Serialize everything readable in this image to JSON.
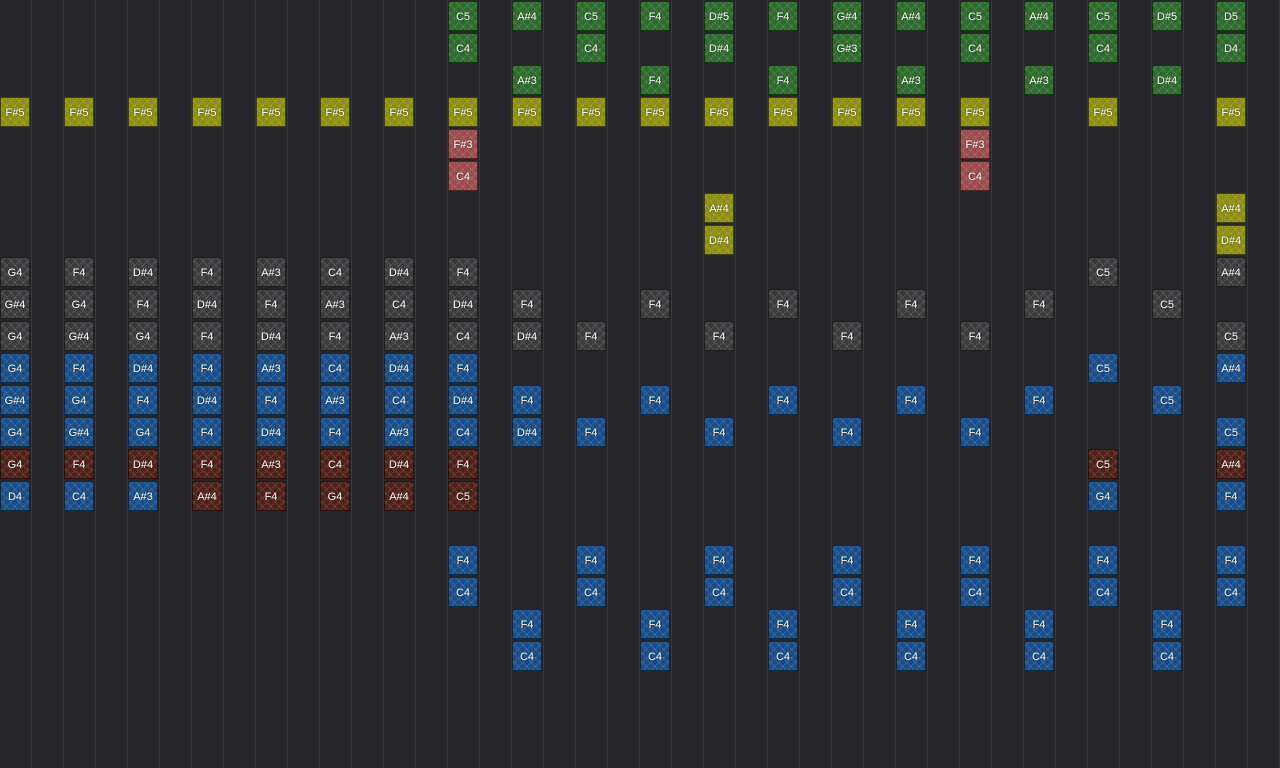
{
  "colors": {
    "background": "#262628",
    "green": "#2e6b2e",
    "yellow": "#8e8e12",
    "red": "#9c4d4e",
    "gray": "#3c3c3e",
    "blue": "#1b4e88",
    "maroon": "#4f2118"
  },
  "column_count": 40,
  "notes": [
    {
      "col": 14,
      "row": 0,
      "label": "C5",
      "kind": "green"
    },
    {
      "col": 14,
      "row": 1,
      "label": "C4",
      "kind": "green"
    },
    {
      "col": 16,
      "row": 0,
      "label": "A#4",
      "kind": "green"
    },
    {
      "col": 16,
      "row": 2,
      "label": "A#3",
      "kind": "green"
    },
    {
      "col": 18,
      "row": 0,
      "label": "C5",
      "kind": "green"
    },
    {
      "col": 18,
      "row": 1,
      "label": "C4",
      "kind": "green"
    },
    {
      "col": 20,
      "row": 0,
      "label": "F4",
      "kind": "green"
    },
    {
      "col": 20,
      "row": 2,
      "label": "F4",
      "kind": "green"
    },
    {
      "col": 22,
      "row": 0,
      "label": "D#5",
      "kind": "green"
    },
    {
      "col": 22,
      "row": 1,
      "label": "D#4",
      "kind": "green"
    },
    {
      "col": 24,
      "row": 0,
      "label": "F4",
      "kind": "green"
    },
    {
      "col": 24,
      "row": 2,
      "label": "F4",
      "kind": "green"
    },
    {
      "col": 26,
      "row": 0,
      "label": "G#4",
      "kind": "green"
    },
    {
      "col": 26,
      "row": 1,
      "label": "G#3",
      "kind": "green"
    },
    {
      "col": 28,
      "row": 0,
      "label": "A#4",
      "kind": "green"
    },
    {
      "col": 28,
      "row": 2,
      "label": "A#3",
      "kind": "green"
    },
    {
      "col": 30,
      "row": 0,
      "label": "C5",
      "kind": "green"
    },
    {
      "col": 30,
      "row": 1,
      "label": "C4",
      "kind": "green"
    },
    {
      "col": 32,
      "row": 0,
      "label": "A#4",
      "kind": "green"
    },
    {
      "col": 32,
      "row": 2,
      "label": "A#3",
      "kind": "green"
    },
    {
      "col": 34,
      "row": 0,
      "label": "C5",
      "kind": "green"
    },
    {
      "col": 34,
      "row": 1,
      "label": "C4",
      "kind": "green"
    },
    {
      "col": 36,
      "row": 0,
      "label": "D#5",
      "kind": "green"
    },
    {
      "col": 36,
      "row": 2,
      "label": "D#4",
      "kind": "green"
    },
    {
      "col": 38,
      "row": 0,
      "label": "D5",
      "kind": "green"
    },
    {
      "col": 38,
      "row": 1,
      "label": "D4",
      "kind": "green"
    },
    {
      "col": 0,
      "row": 3,
      "label": "F#5",
      "kind": "yellow"
    },
    {
      "col": 2,
      "row": 3,
      "label": "F#5",
      "kind": "yellow"
    },
    {
      "col": 4,
      "row": 3,
      "label": "F#5",
      "kind": "yellow"
    },
    {
      "col": 6,
      "row": 3,
      "label": "F#5",
      "kind": "yellow"
    },
    {
      "col": 8,
      "row": 3,
      "label": "F#5",
      "kind": "yellow"
    },
    {
      "col": 10,
      "row": 3,
      "label": "F#5",
      "kind": "yellow"
    },
    {
      "col": 12,
      "row": 3,
      "label": "F#5",
      "kind": "yellow"
    },
    {
      "col": 14,
      "row": 3,
      "label": "F#5",
      "kind": "yellow"
    },
    {
      "col": 16,
      "row": 3,
      "label": "F#5",
      "kind": "yellow"
    },
    {
      "col": 18,
      "row": 3,
      "label": "F#5",
      "kind": "yellow"
    },
    {
      "col": 20,
      "row": 3,
      "label": "F#5",
      "kind": "yellow"
    },
    {
      "col": 22,
      "row": 3,
      "label": "F#5",
      "kind": "yellow"
    },
    {
      "col": 24,
      "row": 3,
      "label": "F#5",
      "kind": "yellow"
    },
    {
      "col": 26,
      "row": 3,
      "label": "F#5",
      "kind": "yellow"
    },
    {
      "col": 28,
      "row": 3,
      "label": "F#5",
      "kind": "yellow"
    },
    {
      "col": 30,
      "row": 3,
      "label": "F#5",
      "kind": "yellow"
    },
    {
      "col": 34,
      "row": 3,
      "label": "F#5",
      "kind": "yellow"
    },
    {
      "col": 38,
      "row": 3,
      "label": "F#5",
      "kind": "yellow"
    },
    {
      "col": 14,
      "row": 4,
      "label": "F#3",
      "kind": "red"
    },
    {
      "col": 14,
      "row": 5,
      "label": "C4",
      "kind": "red"
    },
    {
      "col": 30,
      "row": 4,
      "label": "F#3",
      "kind": "red"
    },
    {
      "col": 30,
      "row": 5,
      "label": "C4",
      "kind": "red"
    },
    {
      "col": 22,
      "row": 6,
      "label": "A#4",
      "kind": "yellow"
    },
    {
      "col": 22,
      "row": 7,
      "label": "D#4",
      "kind": "yellow"
    },
    {
      "col": 38,
      "row": 6,
      "label": "A#4",
      "kind": "yellow"
    },
    {
      "col": 38,
      "row": 7,
      "label": "D#4",
      "kind": "yellow"
    },
    {
      "col": 0,
      "row": 8,
      "label": "G4",
      "kind": "gray"
    },
    {
      "col": 2,
      "row": 8,
      "label": "F4",
      "kind": "gray"
    },
    {
      "col": 4,
      "row": 8,
      "label": "D#4",
      "kind": "gray"
    },
    {
      "col": 6,
      "row": 8,
      "label": "F4",
      "kind": "gray"
    },
    {
      "col": 8,
      "row": 8,
      "label": "A#3",
      "kind": "gray"
    },
    {
      "col": 10,
      "row": 8,
      "label": "C4",
      "kind": "gray"
    },
    {
      "col": 12,
      "row": 8,
      "label": "D#4",
      "kind": "gray"
    },
    {
      "col": 14,
      "row": 8,
      "label": "F4",
      "kind": "gray"
    },
    {
      "col": 34,
      "row": 8,
      "label": "C5",
      "kind": "gray"
    },
    {
      "col": 38,
      "row": 8,
      "label": "A#4",
      "kind": "gray"
    },
    {
      "col": 0,
      "row": 9,
      "label": "G#4",
      "kind": "gray"
    },
    {
      "col": 2,
      "row": 9,
      "label": "G4",
      "kind": "gray"
    },
    {
      "col": 4,
      "row": 9,
      "label": "F4",
      "kind": "gray"
    },
    {
      "col": 6,
      "row": 9,
      "label": "D#4",
      "kind": "gray"
    },
    {
      "col": 8,
      "row": 9,
      "label": "F4",
      "kind": "gray"
    },
    {
      "col": 10,
      "row": 9,
      "label": "A#3",
      "kind": "gray"
    },
    {
      "col": 12,
      "row": 9,
      "label": "C4",
      "kind": "gray"
    },
    {
      "col": 14,
      "row": 9,
      "label": "D#4",
      "kind": "gray"
    },
    {
      "col": 16,
      "row": 9,
      "label": "F4",
      "kind": "gray"
    },
    {
      "col": 20,
      "row": 9,
      "label": "F4",
      "kind": "gray"
    },
    {
      "col": 24,
      "row": 9,
      "label": "F4",
      "kind": "gray"
    },
    {
      "col": 28,
      "row": 9,
      "label": "F4",
      "kind": "gray"
    },
    {
      "col": 32,
      "row": 9,
      "label": "F4",
      "kind": "gray"
    },
    {
      "col": 36,
      "row": 9,
      "label": "C5",
      "kind": "gray"
    },
    {
      "col": 0,
      "row": 10,
      "label": "G4",
      "kind": "gray"
    },
    {
      "col": 2,
      "row": 10,
      "label": "G#4",
      "kind": "gray"
    },
    {
      "col": 4,
      "row": 10,
      "label": "G4",
      "kind": "gray"
    },
    {
      "col": 6,
      "row": 10,
      "label": "F4",
      "kind": "gray"
    },
    {
      "col": 8,
      "row": 10,
      "label": "D#4",
      "kind": "gray"
    },
    {
      "col": 10,
      "row": 10,
      "label": "F4",
      "kind": "gray"
    },
    {
      "col": 12,
      "row": 10,
      "label": "A#3",
      "kind": "gray"
    },
    {
      "col": 14,
      "row": 10,
      "label": "C4",
      "kind": "gray"
    },
    {
      "col": 16,
      "row": 10,
      "label": "D#4",
      "kind": "gray"
    },
    {
      "col": 18,
      "row": 10,
      "label": "F4",
      "kind": "gray"
    },
    {
      "col": 22,
      "row": 10,
      "label": "F4",
      "kind": "gray"
    },
    {
      "col": 26,
      "row": 10,
      "label": "F4",
      "kind": "gray"
    },
    {
      "col": 30,
      "row": 10,
      "label": "F4",
      "kind": "gray"
    },
    {
      "col": 38,
      "row": 10,
      "label": "C5",
      "kind": "gray"
    },
    {
      "col": 0,
      "row": 11,
      "label": "G4",
      "kind": "blue"
    },
    {
      "col": 2,
      "row": 11,
      "label": "F4",
      "kind": "blue"
    },
    {
      "col": 4,
      "row": 11,
      "label": "D#4",
      "kind": "blue"
    },
    {
      "col": 6,
      "row": 11,
      "label": "F4",
      "kind": "blue"
    },
    {
      "col": 8,
      "row": 11,
      "label": "A#3",
      "kind": "blue"
    },
    {
      "col": 10,
      "row": 11,
      "label": "C4",
      "kind": "blue"
    },
    {
      "col": 12,
      "row": 11,
      "label": "D#4",
      "kind": "blue"
    },
    {
      "col": 14,
      "row": 11,
      "label": "F4",
      "kind": "blue"
    },
    {
      "col": 34,
      "row": 11,
      "label": "C5",
      "kind": "blue"
    },
    {
      "col": 38,
      "row": 11,
      "label": "A#4",
      "kind": "blue"
    },
    {
      "col": 0,
      "row": 12,
      "label": "G#4",
      "kind": "blue"
    },
    {
      "col": 2,
      "row": 12,
      "label": "G4",
      "kind": "blue"
    },
    {
      "col": 4,
      "row": 12,
      "label": "F4",
      "kind": "blue"
    },
    {
      "col": 6,
      "row": 12,
      "label": "D#4",
      "kind": "blue"
    },
    {
      "col": 8,
      "row": 12,
      "label": "F4",
      "kind": "blue"
    },
    {
      "col": 10,
      "row": 12,
      "label": "A#3",
      "kind": "blue"
    },
    {
      "col": 12,
      "row": 12,
      "label": "C4",
      "kind": "blue"
    },
    {
      "col": 14,
      "row": 12,
      "label": "D#4",
      "kind": "blue"
    },
    {
      "col": 16,
      "row": 12,
      "label": "F4",
      "kind": "blue"
    },
    {
      "col": 20,
      "row": 12,
      "label": "F4",
      "kind": "blue"
    },
    {
      "col": 24,
      "row": 12,
      "label": "F4",
      "kind": "blue"
    },
    {
      "col": 28,
      "row": 12,
      "label": "F4",
      "kind": "blue"
    },
    {
      "col": 32,
      "row": 12,
      "label": "F4",
      "kind": "blue"
    },
    {
      "col": 36,
      "row": 12,
      "label": "C5",
      "kind": "blue"
    },
    {
      "col": 0,
      "row": 13,
      "label": "G4",
      "kind": "blue"
    },
    {
      "col": 2,
      "row": 13,
      "label": "G#4",
      "kind": "blue"
    },
    {
      "col": 4,
      "row": 13,
      "label": "G4",
      "kind": "blue"
    },
    {
      "col": 6,
      "row": 13,
      "label": "F4",
      "kind": "blue"
    },
    {
      "col": 8,
      "row": 13,
      "label": "D#4",
      "kind": "blue"
    },
    {
      "col": 10,
      "row": 13,
      "label": "F4",
      "kind": "blue"
    },
    {
      "col": 12,
      "row": 13,
      "label": "A#3",
      "kind": "blue"
    },
    {
      "col": 14,
      "row": 13,
      "label": "C4",
      "kind": "blue"
    },
    {
      "col": 16,
      "row": 13,
      "label": "D#4",
      "kind": "blue"
    },
    {
      "col": 18,
      "row": 13,
      "label": "F4",
      "kind": "blue"
    },
    {
      "col": 22,
      "row": 13,
      "label": "F4",
      "kind": "blue"
    },
    {
      "col": 26,
      "row": 13,
      "label": "F4",
      "kind": "blue"
    },
    {
      "col": 30,
      "row": 13,
      "label": "F4",
      "kind": "blue"
    },
    {
      "col": 38,
      "row": 13,
      "label": "C5",
      "kind": "blue"
    },
    {
      "col": 0,
      "row": 14,
      "label": "G4",
      "kind": "maroon"
    },
    {
      "col": 2,
      "row": 14,
      "label": "F4",
      "kind": "maroon"
    },
    {
      "col": 4,
      "row": 14,
      "label": "D#4",
      "kind": "maroon"
    },
    {
      "col": 6,
      "row": 14,
      "label": "F4",
      "kind": "maroon"
    },
    {
      "col": 8,
      "row": 14,
      "label": "A#3",
      "kind": "maroon"
    },
    {
      "col": 10,
      "row": 14,
      "label": "C4",
      "kind": "maroon"
    },
    {
      "col": 12,
      "row": 14,
      "label": "D#4",
      "kind": "maroon"
    },
    {
      "col": 14,
      "row": 14,
      "label": "F4",
      "kind": "maroon"
    },
    {
      "col": 34,
      "row": 14,
      "label": "C5",
      "kind": "maroon"
    },
    {
      "col": 38,
      "row": 14,
      "label": "A#4",
      "kind": "maroon"
    },
    {
      "col": 0,
      "row": 15,
      "label": "D4",
      "kind": "blue"
    },
    {
      "col": 2,
      "row": 15,
      "label": "C4",
      "kind": "blue"
    },
    {
      "col": 4,
      "row": 15,
      "label": "A#3",
      "kind": "blue"
    },
    {
      "col": 6,
      "row": 15,
      "label": "A#4",
      "kind": "maroon"
    },
    {
      "col": 8,
      "row": 15,
      "label": "F4",
      "kind": "maroon"
    },
    {
      "col": 10,
      "row": 15,
      "label": "G4",
      "kind": "maroon"
    },
    {
      "col": 12,
      "row": 15,
      "label": "A#4",
      "kind": "maroon"
    },
    {
      "col": 14,
      "row": 15,
      "label": "C5",
      "kind": "maroon"
    },
    {
      "col": 34,
      "row": 15,
      "label": "G4",
      "kind": "blue"
    },
    {
      "col": 38,
      "row": 15,
      "label": "F4",
      "kind": "blue"
    },
    {
      "col": 14,
      "row": 17,
      "label": "F4",
      "kind": "blue"
    },
    {
      "col": 14,
      "row": 18,
      "label": "C4",
      "kind": "blue"
    },
    {
      "col": 18,
      "row": 17,
      "label": "F4",
      "kind": "blue"
    },
    {
      "col": 18,
      "row": 18,
      "label": "C4",
      "kind": "blue"
    },
    {
      "col": 22,
      "row": 17,
      "label": "F4",
      "kind": "blue"
    },
    {
      "col": 22,
      "row": 18,
      "label": "C4",
      "kind": "blue"
    },
    {
      "col": 26,
      "row": 17,
      "label": "F4",
      "kind": "blue"
    },
    {
      "col": 26,
      "row": 18,
      "label": "C4",
      "kind": "blue"
    },
    {
      "col": 30,
      "row": 17,
      "label": "F4",
      "kind": "blue"
    },
    {
      "col": 30,
      "row": 18,
      "label": "C4",
      "kind": "blue"
    },
    {
      "col": 34,
      "row": 17,
      "label": "F4",
      "kind": "blue"
    },
    {
      "col": 34,
      "row": 18,
      "label": "C4",
      "kind": "blue"
    },
    {
      "col": 38,
      "row": 17,
      "label": "F4",
      "kind": "blue"
    },
    {
      "col": 38,
      "row": 18,
      "label": "C4",
      "kind": "blue"
    },
    {
      "col": 16,
      "row": 19,
      "label": "F4",
      "kind": "blue"
    },
    {
      "col": 16,
      "row": 20,
      "label": "C4",
      "kind": "blue"
    },
    {
      "col": 20,
      "row": 19,
      "label": "F4",
      "kind": "blue"
    },
    {
      "col": 20,
      "row": 20,
      "label": "C4",
      "kind": "blue"
    },
    {
      "col": 24,
      "row": 19,
      "label": "F4",
      "kind": "blue"
    },
    {
      "col": 24,
      "row": 20,
      "label": "C4",
      "kind": "blue"
    },
    {
      "col": 28,
      "row": 19,
      "label": "F4",
      "kind": "blue"
    },
    {
      "col": 28,
      "row": 20,
      "label": "C4",
      "kind": "blue"
    },
    {
      "col": 32,
      "row": 19,
      "label": "F4",
      "kind": "blue"
    },
    {
      "col": 32,
      "row": 20,
      "label": "C4",
      "kind": "blue"
    },
    {
      "col": 36,
      "row": 19,
      "label": "F4",
      "kind": "blue"
    },
    {
      "col": 36,
      "row": 20,
      "label": "C4",
      "kind": "blue"
    }
  ]
}
